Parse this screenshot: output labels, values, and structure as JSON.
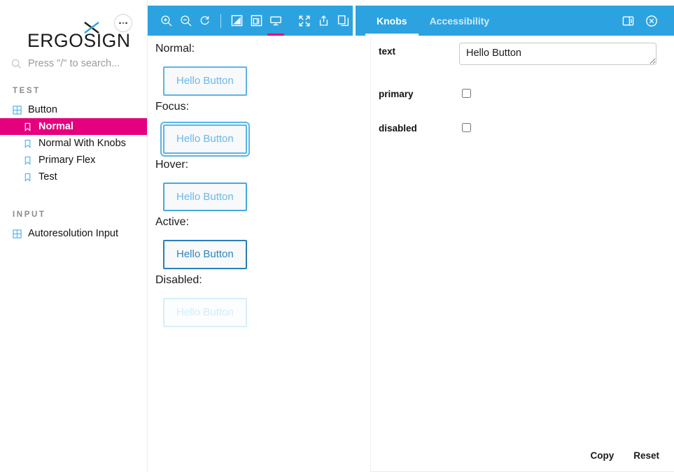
{
  "sidebar": {
    "brand": {
      "word": "ERGOSIGN",
      "mark_icon": "x-logo-icon"
    },
    "menu_button_icon": "ellipsis-icon",
    "search": {
      "placeholder": "Press \"/\" to search...",
      "icon": "search-icon"
    },
    "groups": [
      {
        "heading": "TEST",
        "items": [
          {
            "label": "Button",
            "icon": "component-grid-icon",
            "level": 0,
            "selected": false
          },
          {
            "label": "Normal",
            "icon": "bookmark-icon",
            "level": 1,
            "selected": true
          },
          {
            "label": "Normal With Knobs",
            "icon": "bookmark-icon",
            "level": 1,
            "selected": false
          },
          {
            "label": "Primary Flex",
            "icon": "bookmark-icon",
            "level": 1,
            "selected": false
          },
          {
            "label": "Test",
            "icon": "bookmark-icon",
            "level": 1,
            "selected": false
          }
        ]
      },
      {
        "heading": "INPUT",
        "items": [
          {
            "label": "Autoresolution Input",
            "icon": "component-grid-icon",
            "level": 0,
            "selected": false
          }
        ]
      }
    ]
  },
  "toolbar": {
    "left_tools": [
      {
        "name": "zoom-in-icon",
        "active": false
      },
      {
        "name": "zoom-out-icon",
        "active": false
      },
      {
        "name": "zoom-reset-icon",
        "active": false
      },
      {
        "name": "background-grid-icon",
        "active": false
      },
      {
        "name": "copy-layers-icon",
        "active": false
      },
      {
        "name": "fullscreen-preview-icon",
        "active": true
      },
      {
        "name": "expand-icon",
        "active": false
      },
      {
        "name": "share-icon",
        "active": false
      },
      {
        "name": "copy-link-icon",
        "active": false
      }
    ],
    "tabs": [
      {
        "label": "Knobs",
        "active": true
      },
      {
        "label": "Accessibility",
        "active": false
      }
    ],
    "right_icons": [
      {
        "name": "panel-layout-icon"
      },
      {
        "name": "close-circle-icon"
      }
    ],
    "accent_color": "#2ca3e0",
    "active_marker_color": "#e5007d"
  },
  "preview": {
    "states": [
      {
        "label": "Normal:",
        "button_text": "Hello Button",
        "variant": "normal"
      },
      {
        "label": "Focus:",
        "button_text": "Hello Button",
        "variant": "focus"
      },
      {
        "label": "Hover:",
        "button_text": "Hello Button",
        "variant": "hover"
      },
      {
        "label": "Active:",
        "button_text": "Hello Button",
        "variant": "active"
      },
      {
        "label": "Disabled:",
        "button_text": "Hello Button",
        "variant": "disabled"
      }
    ]
  },
  "knobs": {
    "rows": [
      {
        "name": "text",
        "type": "textarea",
        "value": "Hello Button"
      },
      {
        "name": "primary",
        "type": "checkbox",
        "checked": false
      },
      {
        "name": "disabled",
        "type": "checkbox",
        "checked": false
      }
    ],
    "copy_label": "Copy",
    "reset_label": "Reset"
  }
}
